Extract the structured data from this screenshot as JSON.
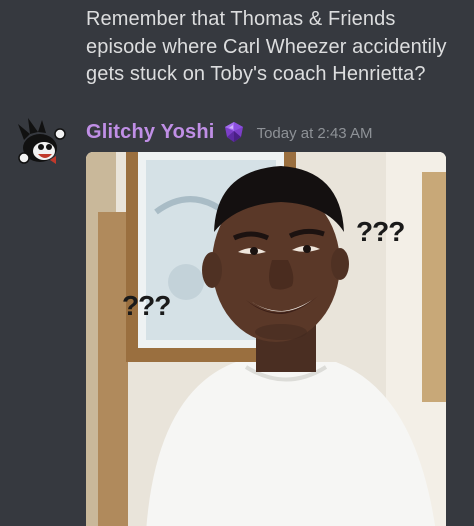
{
  "previous_message": {
    "text": "Remember that Thomas & Friends episode where Carl Wheezer accidentily gets stuck on Toby's coach Henrietta?"
  },
  "message": {
    "author": "Glitchy Yoshi",
    "timestamp": "Today at 2:43 AM",
    "author_color": "#c08fe6",
    "badge_icon": "purple-gem-icon",
    "attachment": {
      "description_labels": {
        "right": "???",
        "left": "???"
      }
    }
  },
  "colors": {
    "background": "#36393f",
    "message_text": "#dcddde",
    "timestamp": "#8e9297"
  }
}
